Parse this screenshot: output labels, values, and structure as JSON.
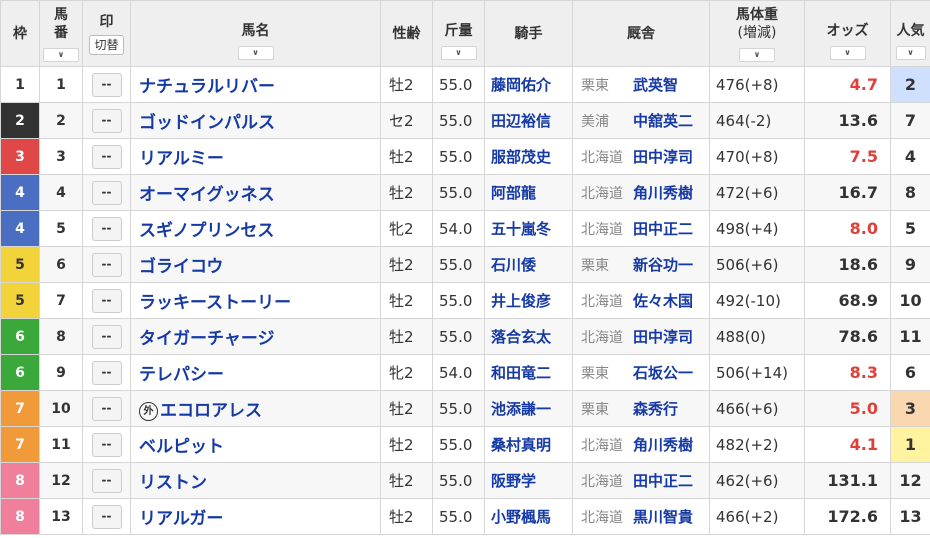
{
  "header": {
    "waku": "枠",
    "umaban": [
      "馬",
      "番"
    ],
    "mark": "印",
    "mark_toggle": "切替",
    "horse_name": "馬名",
    "sex_age": "性齢",
    "weight": "斤量",
    "jockey": "騎手",
    "stable": "厩舎",
    "body_weight": [
      "馬体重",
      "(増減)"
    ],
    "odds": "オッズ",
    "popularity": "人気",
    "sort_arrow": "∨"
  },
  "colors": {
    "waku": {
      "1": {
        "bg": "#ffffff",
        "fg": "#333333"
      },
      "2": {
        "bg": "#333333",
        "fg": "#ffffff"
      },
      "3": {
        "bg": "#e04848",
        "fg": "#ffffff"
      },
      "4": {
        "bg": "#4a6fc2",
        "fg": "#ffffff"
      },
      "5": {
        "bg": "#f2d43a",
        "fg": "#333333"
      },
      "6": {
        "bg": "#3aa83a",
        "fg": "#ffffff"
      },
      "7": {
        "bg": "#f09a3a",
        "fg": "#ffffff"
      },
      "8": {
        "bg": "#ef7f9a",
        "fg": "#ffffff"
      }
    },
    "pop1": "#fff3a0",
    "pop2": "#cfe0ff",
    "pop3": "#fbd7b0",
    "odds_fav": "#e0403a"
  },
  "rows": [
    {
      "waku": "1",
      "umaban": "1",
      "mark": "--",
      "gai": false,
      "name": "ナチュラルリバー",
      "sex": "牡2",
      "weight": "55.0",
      "jockey": "藤岡佑介",
      "region": "栗東",
      "trainer": "武英智",
      "bw": "476(+8)",
      "odds": "4.7",
      "fav": true,
      "pop": "2"
    },
    {
      "waku": "2",
      "umaban": "2",
      "mark": "--",
      "gai": false,
      "name": "ゴッドインパルス",
      "sex": "セ2",
      "weight": "55.0",
      "jockey": "田辺裕信",
      "region": "美浦",
      "trainer": "中舘英二",
      "bw": "464(-2)",
      "odds": "13.6",
      "fav": false,
      "pop": "7"
    },
    {
      "waku": "3",
      "umaban": "3",
      "mark": "--",
      "gai": false,
      "name": "リアルミー",
      "sex": "牡2",
      "weight": "55.0",
      "jockey": "服部茂史",
      "region": "北海道",
      "trainer": "田中淳司",
      "bw": "470(+8)",
      "odds": "7.5",
      "fav": true,
      "pop": "4"
    },
    {
      "waku": "4",
      "umaban": "4",
      "mark": "--",
      "gai": false,
      "name": "オーマイグッネス",
      "sex": "牡2",
      "weight": "55.0",
      "jockey": "阿部龍",
      "region": "北海道",
      "trainer": "角川秀樹",
      "bw": "472(+6)",
      "odds": "16.7",
      "fav": false,
      "pop": "8"
    },
    {
      "waku": "4",
      "umaban": "5",
      "mark": "--",
      "gai": false,
      "name": "スギノプリンセス",
      "sex": "牝2",
      "weight": "54.0",
      "jockey": "五十嵐冬",
      "region": "北海道",
      "trainer": "田中正二",
      "bw": "498(+4)",
      "odds": "8.0",
      "fav": true,
      "pop": "5"
    },
    {
      "waku": "5",
      "umaban": "6",
      "mark": "--",
      "gai": false,
      "name": "ゴライコウ",
      "sex": "牡2",
      "weight": "55.0",
      "jockey": "石川倭",
      "region": "栗東",
      "trainer": "新谷功一",
      "bw": "506(+6)",
      "odds": "18.6",
      "fav": false,
      "pop": "9"
    },
    {
      "waku": "5",
      "umaban": "7",
      "mark": "--",
      "gai": false,
      "name": "ラッキーストーリー",
      "sex": "牡2",
      "weight": "55.0",
      "jockey": "井上俊彦",
      "region": "北海道",
      "trainer": "佐々木国",
      "bw": "492(-10)",
      "odds": "68.9",
      "fav": false,
      "pop": "10"
    },
    {
      "waku": "6",
      "umaban": "8",
      "mark": "--",
      "gai": false,
      "name": "タイガーチャージ",
      "sex": "牡2",
      "weight": "55.0",
      "jockey": "落合玄太",
      "region": "北海道",
      "trainer": "田中淳司",
      "bw": "488(0)",
      "odds": "78.6",
      "fav": false,
      "pop": "11"
    },
    {
      "waku": "6",
      "umaban": "9",
      "mark": "--",
      "gai": false,
      "name": "テレパシー",
      "sex": "牝2",
      "weight": "54.0",
      "jockey": "和田竜二",
      "region": "栗東",
      "trainer": "石坂公一",
      "bw": "506(+14)",
      "odds": "8.3",
      "fav": true,
      "pop": "6"
    },
    {
      "waku": "7",
      "umaban": "10",
      "mark": "--",
      "gai": true,
      "gai_label": "外",
      "name": "エコロアレス",
      "sex": "牡2",
      "weight": "55.0",
      "jockey": "池添謙一",
      "region": "栗東",
      "trainer": "森秀行",
      "bw": "466(+6)",
      "odds": "5.0",
      "fav": true,
      "pop": "3"
    },
    {
      "waku": "7",
      "umaban": "11",
      "mark": "--",
      "gai": false,
      "name": "ベルピット",
      "sex": "牡2",
      "weight": "55.0",
      "jockey": "桑村真明",
      "region": "北海道",
      "trainer": "角川秀樹",
      "bw": "482(+2)",
      "odds": "4.1",
      "fav": true,
      "pop": "1"
    },
    {
      "waku": "8",
      "umaban": "12",
      "mark": "--",
      "gai": false,
      "name": "リストン",
      "sex": "牡2",
      "weight": "55.0",
      "jockey": "阪野学",
      "region": "北海道",
      "trainer": "田中正二",
      "bw": "462(+6)",
      "odds": "131.1",
      "fav": false,
      "pop": "12"
    },
    {
      "waku": "8",
      "umaban": "13",
      "mark": "--",
      "gai": false,
      "name": "リアルガー",
      "sex": "牡2",
      "weight": "55.0",
      "jockey": "小野楓馬",
      "region": "北海道",
      "trainer": "黒川智貴",
      "bw": "466(+2)",
      "odds": "172.6",
      "fav": false,
      "pop": "13"
    }
  ]
}
